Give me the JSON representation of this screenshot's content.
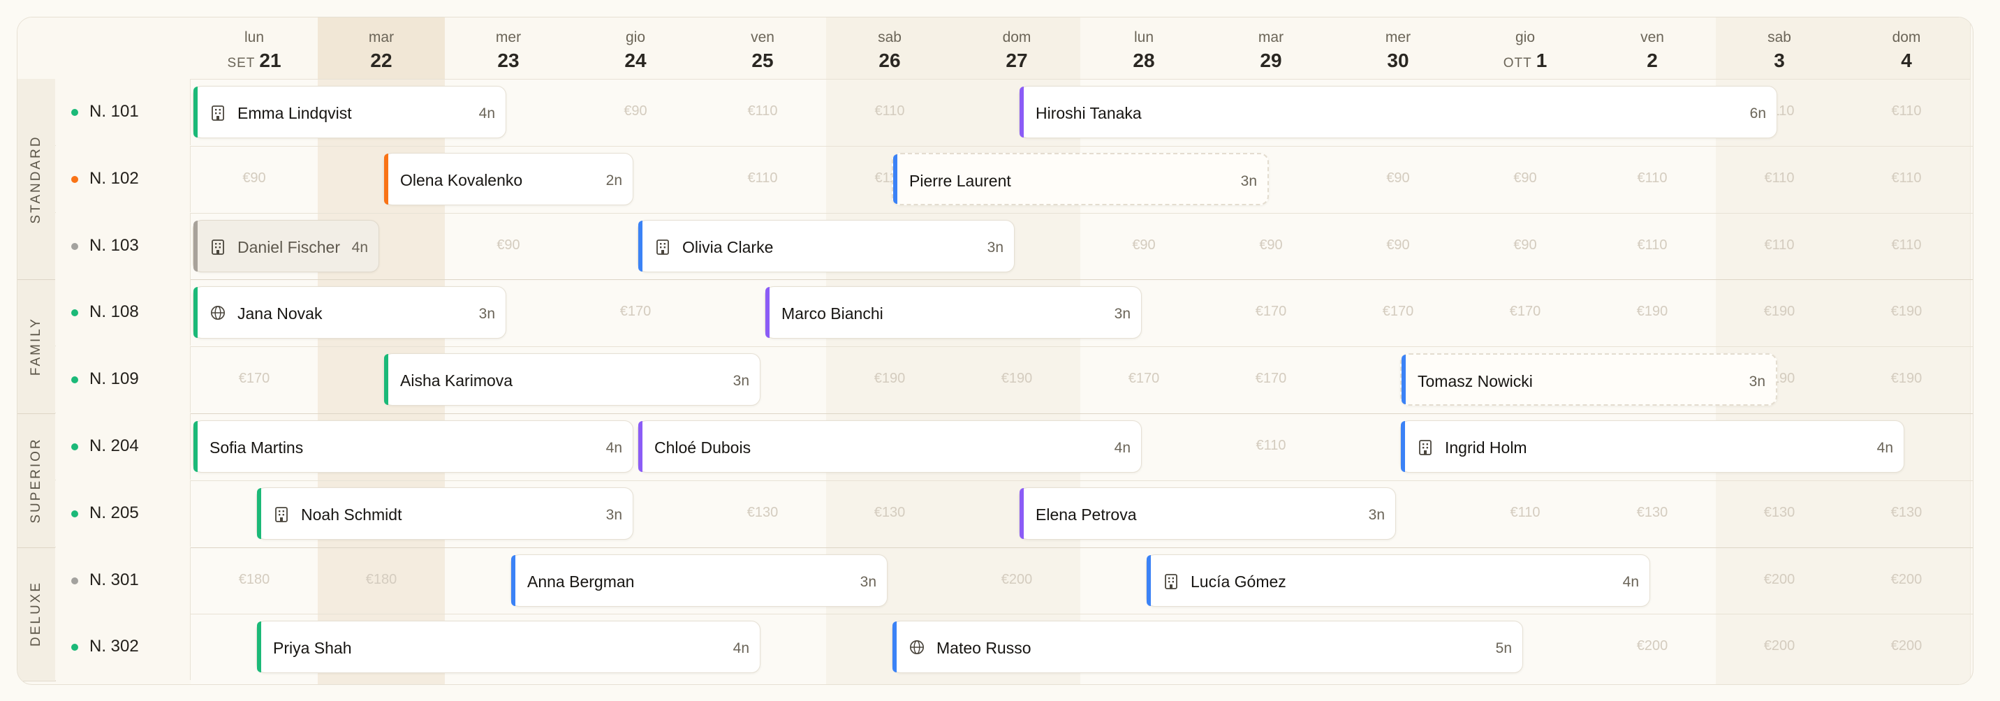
{
  "calendar": {
    "days": [
      {
        "name": "lun",
        "date": "21",
        "month": "SET",
        "weekend": false,
        "today": false
      },
      {
        "name": "mar",
        "date": "22",
        "month": "",
        "weekend": false,
        "today": true
      },
      {
        "name": "mer",
        "date": "23",
        "month": "",
        "weekend": false,
        "today": false
      },
      {
        "name": "gio",
        "date": "24",
        "month": "",
        "weekend": false,
        "today": false
      },
      {
        "name": "ven",
        "date": "25",
        "month": "",
        "weekend": false,
        "today": false
      },
      {
        "name": "sab",
        "date": "26",
        "month": "",
        "weekend": true,
        "today": false
      },
      {
        "name": "dom",
        "date": "27",
        "month": "",
        "weekend": true,
        "today": false
      },
      {
        "name": "lun",
        "date": "28",
        "month": "",
        "weekend": false,
        "today": false
      },
      {
        "name": "mar",
        "date": "29",
        "month": "",
        "weekend": false,
        "today": false
      },
      {
        "name": "mer",
        "date": "30",
        "month": "",
        "weekend": false,
        "today": false
      },
      {
        "name": "gio",
        "date": "1",
        "month": "OTT",
        "weekend": false,
        "today": false
      },
      {
        "name": "ven",
        "date": "2",
        "month": "",
        "weekend": false,
        "today": false
      },
      {
        "name": "sab",
        "date": "3",
        "month": "",
        "weekend": true,
        "today": false
      },
      {
        "name": "dom",
        "date": "4",
        "month": "",
        "weekend": true,
        "today": false
      }
    ],
    "groups": [
      {
        "label": "STANDARD",
        "rooms": [
          {
            "name": "N. 101",
            "status_color": "#1bb978",
            "prices": [
              "",
              "",
              "",
              "€90",
              "€110",
              "€110",
              "",
              "",
              "",
              "",
              "",
              "",
              "€110",
              "€110"
            ],
            "bookings": [
              {
                "guest": "Emma Lindqvist",
                "nights": "4n",
                "start": 0,
                "span": 2.5,
                "color": "#1bb978",
                "icon": "building-icon",
                "style": "normal"
              },
              {
                "guest": "Hiroshi Tanaka",
                "nights": "6n",
                "start": 6.5,
                "span": 6,
                "color": "#8b5cf6",
                "icon": "",
                "style": "normal"
              }
            ]
          },
          {
            "name": "N. 102",
            "status_color": "#f97316",
            "prices": [
              "€90",
              "",
              "",
              "",
              "€110",
              "€110",
              "",
              "",
              "",
              "€90",
              "€90",
              "€110",
              "€110",
              "€110"
            ],
            "bookings": [
              {
                "guest": "Olena Kovalenko",
                "nights": "2n",
                "start": 1.5,
                "span": 2,
                "color": "#f97316",
                "icon": "",
                "style": "normal"
              },
              {
                "guest": "Pierre Laurent",
                "nights": "3n",
                "start": 5.5,
                "span": 3,
                "color": "#3b82f6",
                "icon": "",
                "style": "pending"
              }
            ]
          },
          {
            "name": "N. 103",
            "status_color": "#a3a29e",
            "prices": [
              "",
              "",
              "€90",
              "",
              "",
              "",
              "",
              "€90",
              "€90",
              "€90",
              "€90",
              "€110",
              "€110",
              "€110"
            ],
            "bookings": [
              {
                "guest": "Daniel Fischer",
                "nights": "4n",
                "start": 0,
                "span": 1.5,
                "color": "#a8a29a",
                "icon": "building-icon",
                "style": "muted"
              },
              {
                "guest": "Olivia Clarke",
                "nights": "3n",
                "start": 3.5,
                "span": 3,
                "color": "#3b82f6",
                "icon": "building-icon",
                "style": "normal"
              }
            ]
          }
        ]
      },
      {
        "label": "FAMILY",
        "rooms": [
          {
            "name": "N. 108",
            "status_color": "#1bb978",
            "prices": [
              "",
              "",
              "",
              "€170",
              "",
              "",
              "",
              "",
              "€170",
              "€170",
              "€170",
              "€190",
              "€190",
              "€190"
            ],
            "bookings": [
              {
                "guest": "Jana Novak",
                "nights": "3n",
                "start": 0,
                "span": 2.5,
                "color": "#1bb978",
                "icon": "globe-icon",
                "style": "normal"
              },
              {
                "guest": "Marco Bianchi",
                "nights": "3n",
                "start": 4.5,
                "span": 3,
                "color": "#8b5cf6",
                "icon": "",
                "style": "normal"
              }
            ]
          },
          {
            "name": "N. 109",
            "status_color": "#1bb978",
            "prices": [
              "€170",
              "",
              "",
              "",
              "",
              "€190",
              "€190",
              "€170",
              "€170",
              "",
              "",
              "",
              "€190",
              "€190"
            ],
            "bookings": [
              {
                "guest": "Aisha Karimova",
                "nights": "3n",
                "start": 1.5,
                "span": 3,
                "color": "#1bb978",
                "icon": "",
                "style": "normal"
              },
              {
                "guest": "Tomasz Nowicki",
                "nights": "3n",
                "start": 9.5,
                "span": 3,
                "color": "#3b82f6",
                "icon": "",
                "style": "pending"
              }
            ]
          }
        ]
      },
      {
        "label": "SUPERIOR",
        "rooms": [
          {
            "name": "N. 204",
            "status_color": "#1bb978",
            "prices": [
              "",
              "",
              "",
              "",
              "",
              "",
              "",
              "",
              "€110",
              "",
              "",
              "",
              "",
              ""
            ],
            "bookings": [
              {
                "guest": "Sofia Martins",
                "nights": "4n",
                "start": 0,
                "span": 3.5,
                "color": "#1bb978",
                "icon": "",
                "style": "normal"
              },
              {
                "guest": "Chloé Dubois",
                "nights": "4n",
                "start": 3.5,
                "span": 4,
                "color": "#8b5cf6",
                "icon": "",
                "style": "normal"
              },
              {
                "guest": "Ingrid Holm",
                "nights": "4n",
                "start": 9.5,
                "span": 4,
                "color": "#3b82f6",
                "icon": "building-icon",
                "style": "normal"
              }
            ]
          },
          {
            "name": "N. 205",
            "status_color": "#1bb978",
            "prices": [
              "",
              "",
              "",
              "",
              "€130",
              "€130",
              "",
              "",
              "",
              "",
              "€110",
              "€130",
              "€130",
              "€130"
            ],
            "bookings": [
              {
                "guest": "Noah Schmidt",
                "nights": "3n",
                "start": 0.5,
                "span": 3,
                "color": "#1bb978",
                "icon": "building-icon",
                "style": "normal"
              },
              {
                "guest": "Elena Petrova",
                "nights": "3n",
                "start": 6.5,
                "span": 3,
                "color": "#8b5cf6",
                "icon": "",
                "style": "normal"
              }
            ]
          }
        ]
      },
      {
        "label": "DELUXE",
        "rooms": [
          {
            "name": "N. 301",
            "status_color": "#a3a29e",
            "prices": [
              "€180",
              "€180",
              "",
              "",
              "",
              "",
              "€200",
              "",
              "",
              "",
              "",
              "",
              "€200",
              "€200"
            ],
            "bookings": [
              {
                "guest": "Anna Bergman",
                "nights": "3n",
                "start": 2.5,
                "span": 3,
                "color": "#3b82f6",
                "icon": "",
                "style": "normal"
              },
              {
                "guest": "Lucía Gómez",
                "nights": "4n",
                "start": 7.5,
                "span": 4,
                "color": "#3b82f6",
                "icon": "building-icon",
                "style": "normal"
              }
            ]
          },
          {
            "name": "N. 302",
            "status_color": "#1bb978",
            "prices": [
              "",
              "",
              "",
              "",
              "",
              "",
              "",
              "",
              "",
              "",
              "",
              "€200",
              "€200",
              "€200"
            ],
            "bookings": [
              {
                "guest": "Priya Shah",
                "nights": "4n",
                "start": 0.5,
                "span": 4,
                "color": "#1bb978",
                "icon": "",
                "style": "normal"
              },
              {
                "guest": "Mateo Russo",
                "nights": "5n",
                "start": 5.5,
                "span": 5,
                "color": "#3b82f6",
                "icon": "globe-icon",
                "style": "normal"
              }
            ]
          }
        ]
      }
    ]
  }
}
